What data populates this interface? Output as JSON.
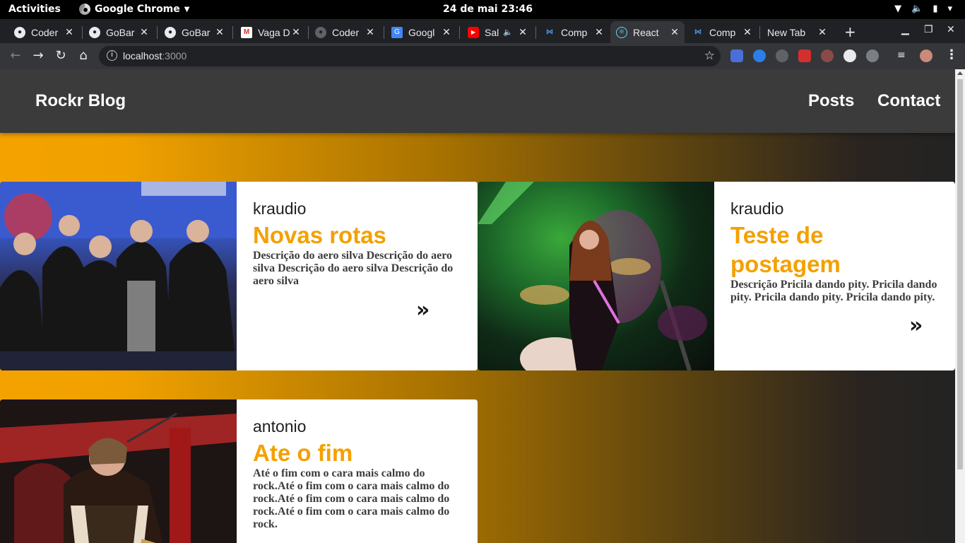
{
  "os": {
    "activities": "Activities",
    "app_name": "Google Chrome",
    "clock": "24 de mai  23:46"
  },
  "browser": {
    "tabs": [
      {
        "title": "Coder",
        "icon": "github-icon"
      },
      {
        "title": "GoBar",
        "icon": "github-icon"
      },
      {
        "title": "GoBar",
        "icon": "github-icon"
      },
      {
        "title": "Vaga D",
        "icon": "gmail-icon"
      },
      {
        "title": "Coder",
        "icon": "github-icon"
      },
      {
        "title": "Googl",
        "icon": "google-translate-icon"
      },
      {
        "title": "Sal",
        "icon": "youtube-icon"
      },
      {
        "title": "Comp",
        "icon": "vscode-icon"
      },
      {
        "title": "React",
        "icon": "react-icon",
        "active": true
      },
      {
        "title": "Comp",
        "icon": "vscode-icon"
      },
      {
        "title": "New Tab",
        "icon": ""
      }
    ],
    "url_host": "localhost",
    "url_port": ":3000"
  },
  "site": {
    "brand": "Rockr Blog",
    "nav": [
      "Posts",
      "Contact"
    ]
  },
  "posts": [
    {
      "author": "kraudio",
      "title": "Novas rotas",
      "description": "Descrição do aero silva Descrição do aero silva Descrição do aero silva Descrição do aero silva",
      "more": "»"
    },
    {
      "author": "kraudio",
      "title": "Teste de postagem",
      "description": "Descrição Pricila dando pity. Pricila dando pity. Pricila dando pity. Pricila dando pity.",
      "more": "»"
    },
    {
      "author": "antonio",
      "title": "Ate o fim",
      "description": "Até o fim com o cara mais calmo do rock.Até o fim com o cara mais calmo do rock.Até o fim com o cara mais calmo do rock.Até o fim com o cara mais calmo do rock.",
      "more": "»"
    }
  ],
  "colors": {
    "accent": "#f4a000",
    "header_bg": "#3b3b3b"
  }
}
